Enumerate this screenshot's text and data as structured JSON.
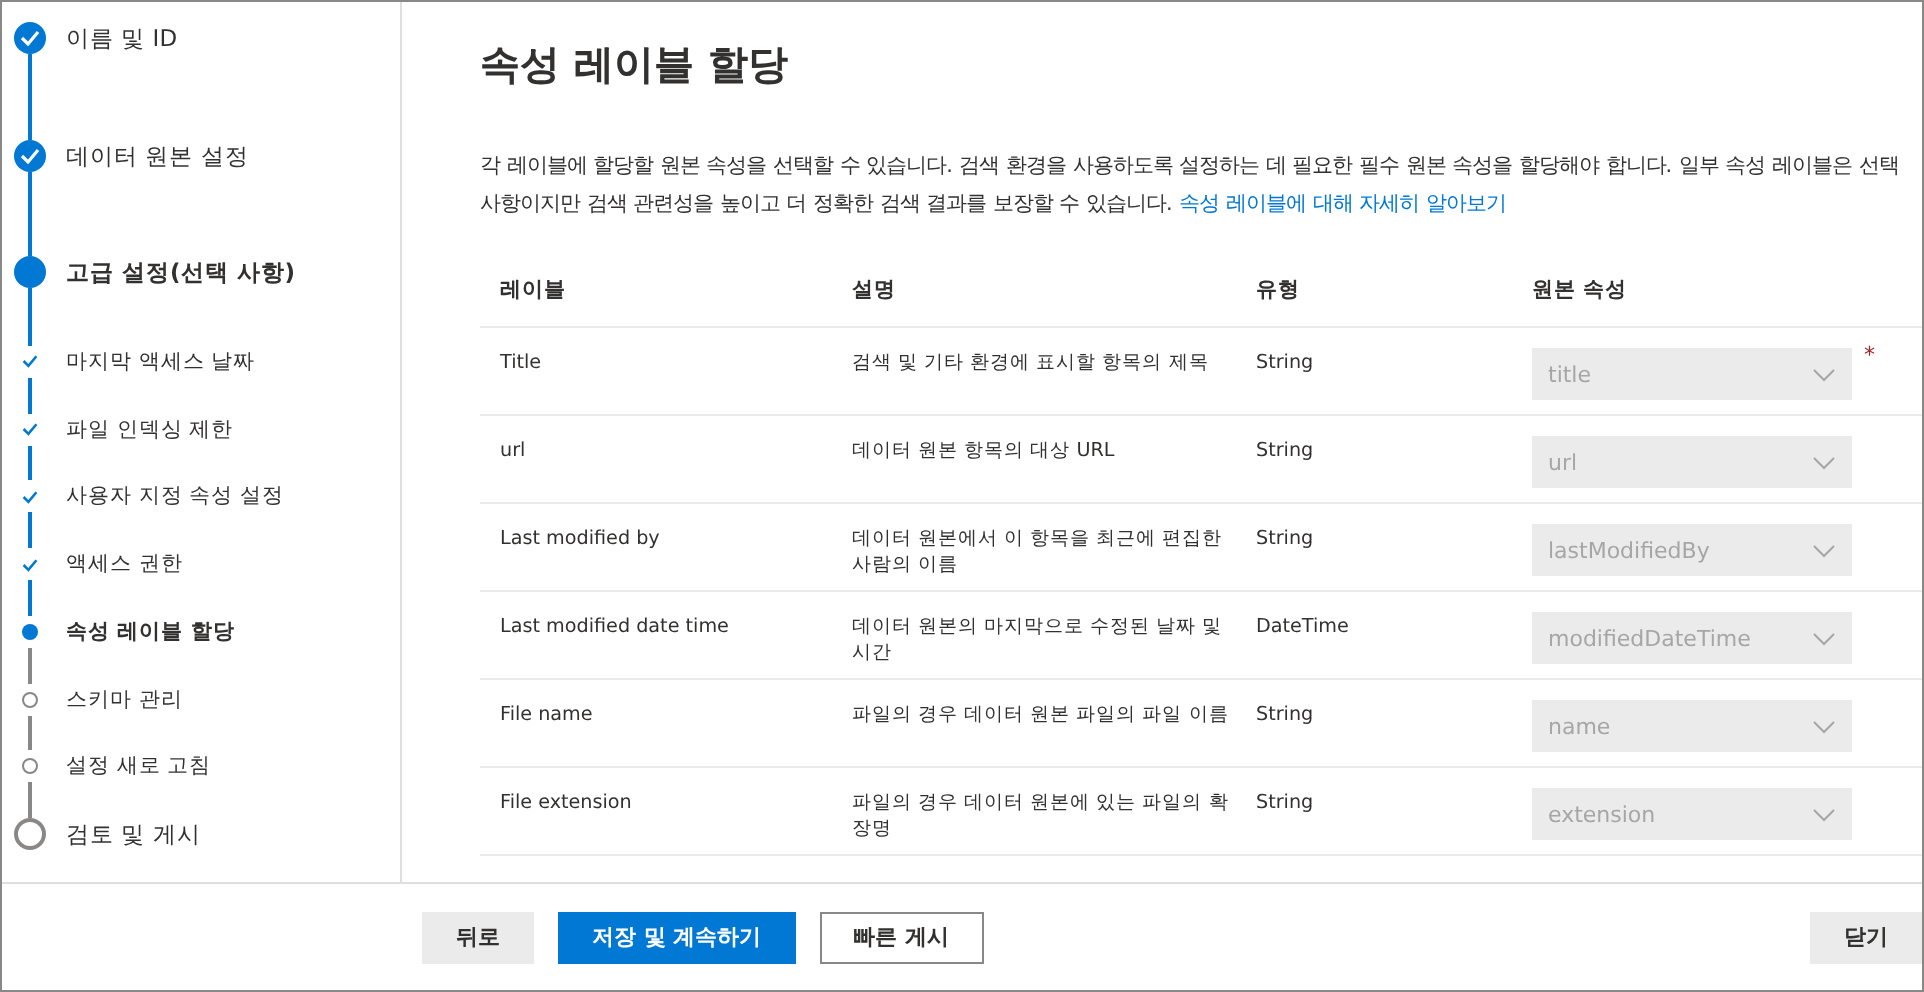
{
  "steps": [
    {
      "label": "이름 및 ID",
      "kind": "step",
      "done": true,
      "current": false
    },
    {
      "label": "데이터 원본 설정",
      "kind": "step",
      "done": true,
      "current": false
    },
    {
      "label": "고급 설정(선택 사항)",
      "kind": "step",
      "done": false,
      "current": true
    },
    {
      "label": "마지막 액세스 날짜",
      "kind": "substep",
      "done": true,
      "current": false
    },
    {
      "label": "파일 인덱싱 제한",
      "kind": "substep",
      "done": true,
      "current": false
    },
    {
      "label": "사용자 지정 속성 설정",
      "kind": "substep",
      "done": true,
      "current": false
    },
    {
      "label": "액세스 권한",
      "kind": "substep",
      "done": true,
      "current": false
    },
    {
      "label": "속성 레이블 할당",
      "kind": "substep",
      "done": false,
      "current": true
    },
    {
      "label": "스키마 관리",
      "kind": "substep",
      "done": false,
      "current": false
    },
    {
      "label": "설정 새로 고침",
      "kind": "substep",
      "done": false,
      "current": false
    },
    {
      "label": "검토 및 게시",
      "kind": "step",
      "done": false,
      "current": false
    }
  ],
  "title": "속성 레이블 할당",
  "description": "각 레이블에 할당할 원본 속성을 선택할 수 있습니다. 검색 환경을 사용하도록 설정하는 데 필요한 필수 원본 속성을 할당해야 합니다. 일부 속성 레이블은 선택사항이지만 검색 관련성을 높이고 더 정확한 검색 결과를 보장할 수 있습니다.",
  "learn_more_link": "속성 레이블에 대해 자세히 알아보기",
  "table": {
    "columns": [
      "레이블",
      "설명",
      "유형",
      "원본 속성"
    ],
    "rows": [
      {
        "label": "Title",
        "description": "검색 및 기타 환경에 표시할 항목의 제목",
        "type": "String",
        "source": "title",
        "required": true,
        "disabled": true
      },
      {
        "label": "url",
        "description": "데이터 원본 항목의 대상 URL",
        "type": "String",
        "source": "url",
        "required": false,
        "disabled": true
      },
      {
        "label": "Last modified by",
        "description": "데이터 원본에서 이 항목을 최근에 편집한 사람의 이름",
        "type": "String",
        "source": "lastModifiedBy",
        "required": false,
        "disabled": true
      },
      {
        "label": "Last modified date time",
        "description": "데이터 원본의 마지막으로 수정된 날짜 및 시간",
        "type": "DateTime",
        "source": "modifiedDateTime",
        "required": false,
        "disabled": true
      },
      {
        "label": "File name",
        "description": "파일의 경우 데이터 원본 파일의 파일 이름",
        "type": "String",
        "source": "name",
        "required": false,
        "disabled": true
      },
      {
        "label": "File extension",
        "description": "파일의 경우 데이터 원본에 있는 파일의 확장명",
        "type": "String",
        "source": "extension",
        "required": false,
        "disabled": true
      }
    ]
  },
  "required_mark": "*",
  "footer": {
    "back": "뒤로",
    "save": "저장 및 계속하기",
    "quick_publish": "빠른 게시",
    "close": "닫기"
  }
}
